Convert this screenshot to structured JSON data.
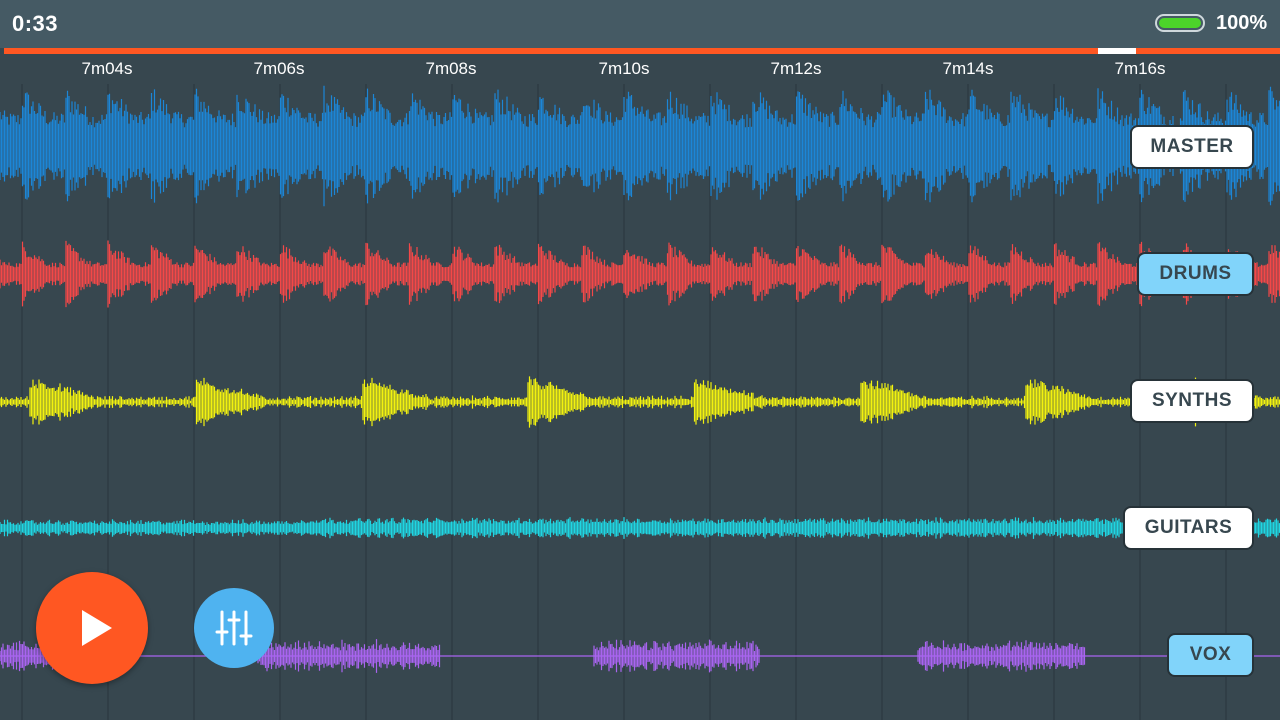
{
  "status_bar": {
    "clock": "0:33",
    "battery_percent": "100%",
    "battery_level": 1.0
  },
  "progress": {
    "fill_color": "#ff5722",
    "thumb_color": "#ffffff",
    "position_fraction": 0.857
  },
  "timeline": {
    "ticks": [
      "7m04s",
      "7m06s",
      "7m08s",
      "7m10s",
      "7m12s",
      "7m14s",
      "7m16s"
    ]
  },
  "tracks": [
    {
      "name": "MASTER",
      "color": "#1c86d6",
      "selected": false
    },
    {
      "name": "DRUMS",
      "color": "#f44848",
      "selected": true
    },
    {
      "name": "SYNTHS",
      "color": "#f2f20f",
      "selected": false
    },
    {
      "name": "GUITARS",
      "color": "#1fd6e2",
      "selected": false
    },
    {
      "name": "VOX",
      "color": "#a964f0",
      "selected": true
    }
  ],
  "controls": {
    "play_icon": "play-icon",
    "mixer_icon": "sliders-icon",
    "play_color": "#ff5722",
    "mixer_color": "#4fb3f0"
  }
}
